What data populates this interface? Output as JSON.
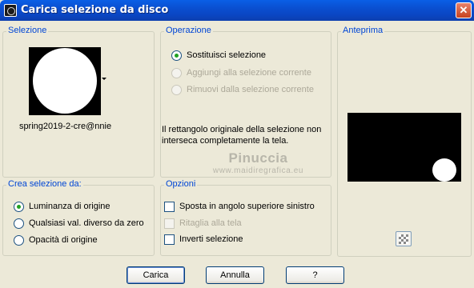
{
  "window": {
    "title": "Carica selezione da disco",
    "close_glyph": "✕"
  },
  "selezione": {
    "legend": "Selezione",
    "filename": "spring2019-2-cre@nnie"
  },
  "operazione": {
    "legend": "Operazione",
    "options": [
      {
        "label": "Sostituisci selezione",
        "checked": true,
        "enabled": true
      },
      {
        "label": "Aggiungi alla selezione corrente",
        "checked": false,
        "enabled": false
      },
      {
        "label": "Rimuovi dalla selezione corrente",
        "checked": false,
        "enabled": false
      }
    ],
    "message": "Il rettangolo originale della selezione non interseca completamente la tela."
  },
  "anteprima": {
    "legend": "Anteprima"
  },
  "crea": {
    "legend": "Crea selezione da:",
    "options": [
      {
        "label": "Luminanza di origine",
        "checked": true
      },
      {
        "label": "Qualsiasi val. diverso da zero",
        "checked": false
      },
      {
        "label": "Opacità di origine",
        "checked": false
      }
    ]
  },
  "opzioni": {
    "legend": "Opzioni",
    "checks": [
      {
        "label": "Sposta in angolo superiore sinistro",
        "checked": false,
        "enabled": true
      },
      {
        "label": "Ritaglia alla tela",
        "checked": false,
        "enabled": false
      },
      {
        "label": "Inverti selezione",
        "checked": false,
        "enabled": true
      }
    ]
  },
  "watermark": {
    "name": "Pinuccia",
    "site": "www.maidiregrafica.eu"
  },
  "buttons": {
    "load": "Carica",
    "cancel": "Annulla",
    "help": "?"
  },
  "colors": {
    "accent": "#0046d5",
    "title_bar": "#0a4fd0",
    "dialog_bg": "#ece9d8"
  }
}
